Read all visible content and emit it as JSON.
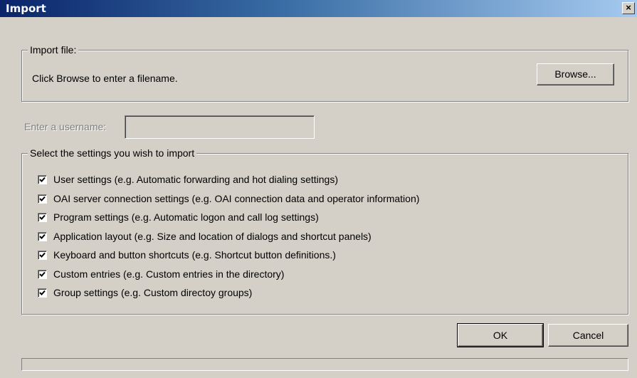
{
  "window": {
    "title": "Import",
    "close_glyph": "×"
  },
  "import_file": {
    "legend": "Import file:",
    "hint": "Click Browse to enter a filename.",
    "browse_label": "Browse..."
  },
  "username": {
    "label": "Enter a username:",
    "value": ""
  },
  "settings": {
    "legend": "Select the settings you wish to import",
    "items": [
      {
        "label": "User settings  (e.g. Automatic forwarding and hot dialing settings)",
        "checked": true
      },
      {
        "label": "OAI server connection settings (e.g. OAI connection data and operator information)",
        "checked": true
      },
      {
        "label": "Program settings (e.g. Automatic logon and call log settings)",
        "checked": true
      },
      {
        "label": "Application layout (e.g. Size and location of dialogs and shortcut panels)",
        "checked": true
      },
      {
        "label": "Keyboard and button shortcuts (e.g. Shortcut button definitions.)",
        "checked": true
      },
      {
        "label": "Custom entries (e.g. Custom entries in the directory)",
        "checked": true
      },
      {
        "label": "Group settings (e.g. Custom directoy groups)",
        "checked": true
      }
    ]
  },
  "buttons": {
    "ok_label": "OK",
    "cancel_label": "Cancel"
  },
  "colors": {
    "title_bar_start": "#0a246a",
    "title_bar_end": "#a6caf0",
    "dialog_face": "#d4d0c8"
  }
}
